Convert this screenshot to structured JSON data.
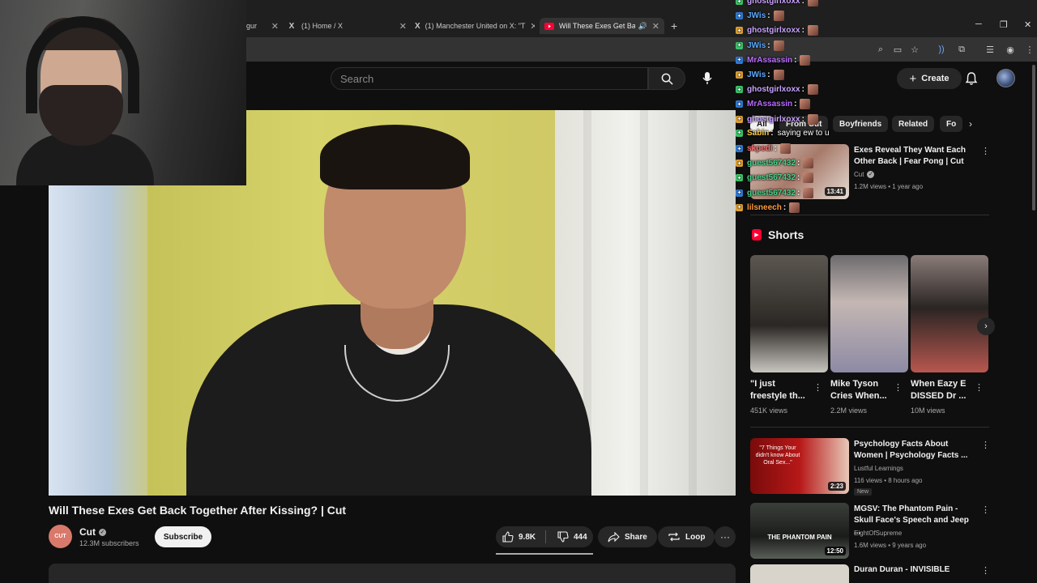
{
  "browser": {
    "tabs": [
      {
        "label": "gur",
        "favicon": ""
      },
      {
        "label": "(1) Home / X",
        "favicon": "X"
      },
      {
        "label": "(1) Manchester United on X: \"T",
        "favicon": "X"
      },
      {
        "label": "Will These Exes Get Back To",
        "favicon": "youtube-icon",
        "active": true
      }
    ],
    "new_tab": "+",
    "window_controls": {
      "minimize": "─",
      "maximize": "❐",
      "close": "✕"
    }
  },
  "header": {
    "search_placeholder": "Search",
    "create_label": "Create"
  },
  "video": {
    "title": "Will These Exes Get Back Together After Kissing? | Cut",
    "channel": {
      "name": "Cut",
      "avatar_text": "CUT",
      "subscribers": "12.3M subscribers"
    },
    "subscribe_label": "Subscribe",
    "likes": "9.8K",
    "dislikes": "444",
    "share_label": "Share",
    "loop_label": "Loop",
    "more": "···"
  },
  "chips": [
    {
      "label": "All",
      "active": true
    },
    {
      "label": "From Cut",
      "active": false
    },
    {
      "label": "Boyfriends",
      "active": false
    },
    {
      "label": "Related",
      "active": false
    },
    {
      "label": "Fo",
      "active": false
    }
  ],
  "recommended_top": {
    "title": "Exes Reveal They Want Each Other Back | Fear Pong | Cut",
    "channel": "Cut",
    "meta": "1.2M views • 1 year ago",
    "duration": "13:41"
  },
  "shorts": {
    "heading": "Shorts",
    "items": [
      {
        "title": "\"I just freestyle th...",
        "views": "451K views"
      },
      {
        "title": "Mike Tyson Cries When...",
        "views": "2.2M views"
      },
      {
        "title": "When Eazy E DISSED Dr ...",
        "views": "10M views"
      }
    ]
  },
  "recommended": [
    {
      "title": "Psychology Facts About Women | Psychology Facts ...",
      "channel": "Lustful Learnings",
      "meta": "116 views • 8 hours ago",
      "badge": "New",
      "duration": "2:23",
      "thumb_text": "\"7 Things Your didn't know About Oral Sex...\""
    },
    {
      "title": "MGSV: The Phantom Pain - Skull Face's Speech and Jeep ...",
      "channel": "EightOfSupreme",
      "meta": "1.6M views • 9 years ago",
      "duration": "12:50",
      "thumb_text": "THE PHANTOM PAIN"
    },
    {
      "title": "Duran Duran - INVISIBLE",
      "channel": "",
      "meta": ""
    }
  ],
  "chat": [
    {
      "user": "ghostgirlxoxx",
      "color": "#c9a3ff"
    },
    {
      "user": "JWis",
      "color": "#5aa9ff"
    },
    {
      "user": "ghostgirlxoxx",
      "color": "#c9a3ff"
    },
    {
      "user": "JWis",
      "color": "#5aa9ff"
    },
    {
      "user": "MrAssassin",
      "color": "#b86bff"
    },
    {
      "user": "JWis",
      "color": "#5aa9ff"
    },
    {
      "user": "ghostgirlxoxx",
      "color": "#c9a3ff"
    },
    {
      "user": "MrAssassin",
      "color": "#b86bff"
    },
    {
      "user": "ghostgirlxoxx",
      "color": "#c9a3ff"
    },
    {
      "user": "Sabin",
      "color": "#ffcf4a",
      "text": "saying ew to u"
    },
    {
      "user": "skpedi",
      "color": "#ff6b6b"
    },
    {
      "user": "guest567432",
      "color": "#4ad38a"
    },
    {
      "user": "guest567432",
      "color": "#4ad38a"
    },
    {
      "user": "guest567432",
      "color": "#4ad38a"
    },
    {
      "user": "lilsneech",
      "color": "#ff9a3c"
    }
  ],
  "colors": {
    "background": "#0f0f0f",
    "surface": "#272727",
    "brand_red": "#ff0033",
    "text_primary": "#f1f1f1",
    "text_secondary": "#aaaaaa"
  }
}
